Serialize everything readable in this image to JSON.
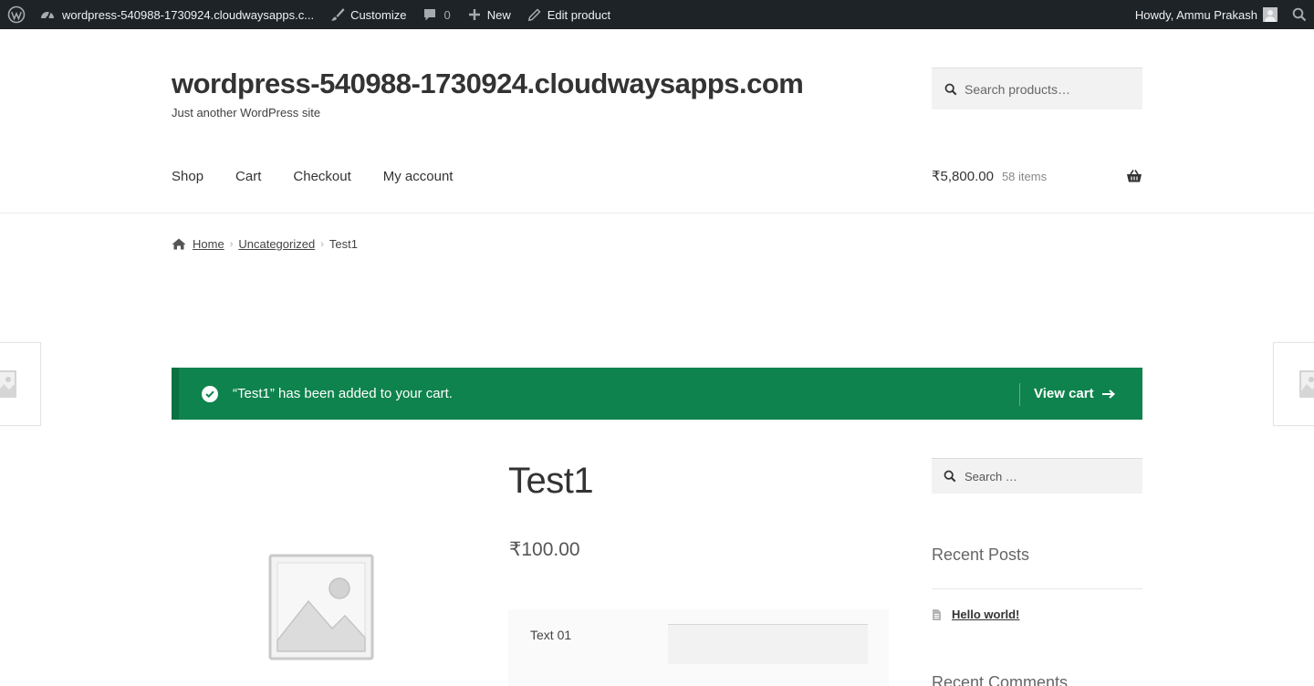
{
  "admin_bar": {
    "site_name": "wordpress-540988-1730924.cloudwaysapps.c...",
    "customize": "Customize",
    "comments_count": "0",
    "new": "New",
    "edit_product": "Edit product",
    "howdy": "Howdy, Ammu Prakash"
  },
  "header": {
    "site_title": "wordpress-540988-1730924.cloudwaysapps.com",
    "tagline": "Just another WordPress site",
    "search_placeholder": "Search products…",
    "nav": [
      "Shop",
      "Cart",
      "Checkout",
      "My account"
    ],
    "cart_amount": "₹5,800.00",
    "cart_count": "58 items"
  },
  "breadcrumb": {
    "home": "Home",
    "category": "Uncategorized",
    "current": "Test1"
  },
  "notice": {
    "message": "“Test1” has been added to your cart.",
    "view_cart": "View cart",
    "color": "#0f834d"
  },
  "product": {
    "title": "Test1",
    "price": "₹100.00",
    "addon_label": "Text 01",
    "addon_value": ""
  },
  "sidebar": {
    "search_placeholder": "Search …",
    "recent_posts_title": "Recent Posts",
    "recent_posts": [
      "Hello world!"
    ],
    "recent_comments_title": "Recent Comments"
  }
}
